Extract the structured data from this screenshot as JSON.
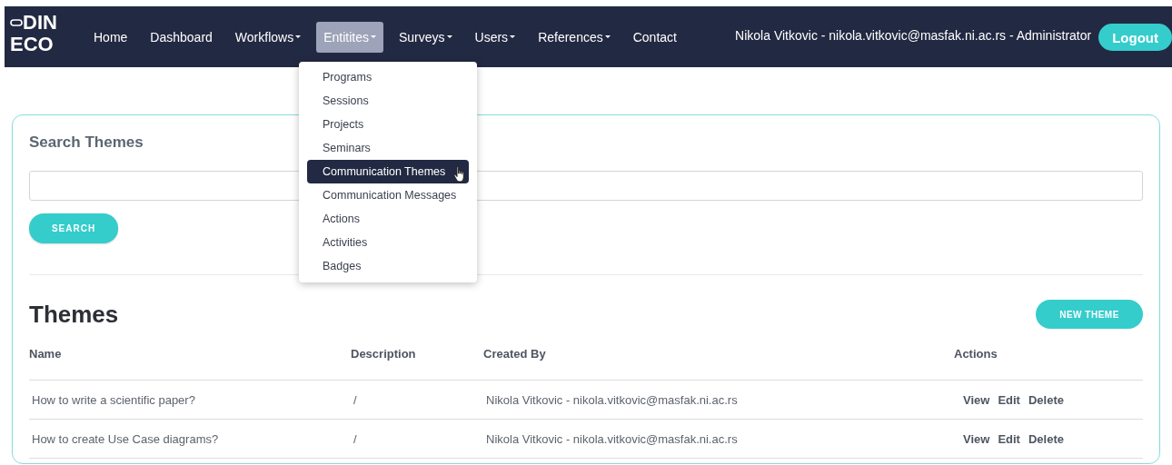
{
  "logo": {
    "line_1": "DIN",
    "line_2": "ECO"
  },
  "nav": {
    "items": [
      {
        "label": "Home",
        "has_menu": false,
        "selected": false
      },
      {
        "label": "Dashboard",
        "has_menu": false,
        "selected": false
      },
      {
        "label": "Workflows",
        "has_menu": true,
        "selected": false
      },
      {
        "label": "Entitites",
        "has_menu": true,
        "selected": true
      },
      {
        "label": "Surveys",
        "has_menu": true,
        "selected": false
      },
      {
        "label": "Users",
        "has_menu": true,
        "selected": false
      },
      {
        "label": "References",
        "has_menu": true,
        "selected": false
      },
      {
        "label": "Contact",
        "has_menu": false,
        "selected": false
      }
    ]
  },
  "user_info": "Nikola Vitkovic - nikola.vitkovic@masfak.ni.ac.rs - Administrator",
  "logout_button": "Logout",
  "dropdown": {
    "items": [
      {
        "label": "Programs",
        "selected": false
      },
      {
        "label": "Sessions",
        "selected": false
      },
      {
        "label": "Projects",
        "selected": false
      },
      {
        "label": "Seminars",
        "selected": false
      },
      {
        "label": "Communication Themes",
        "selected": true
      },
      {
        "label": "Communication Messages",
        "selected": false
      },
      {
        "label": "Actions",
        "selected": false
      },
      {
        "label": "Activities",
        "selected": false
      },
      {
        "label": "Badges",
        "selected": false
      }
    ]
  },
  "search": {
    "title": "Search Themes",
    "button": "SEARCH"
  },
  "themes": {
    "title": "Themes",
    "new_button": "NEW THEME",
    "columns": [
      "Name",
      "Description",
      "Created By",
      "Actions"
    ],
    "rows": [
      {
        "name": "How to write a scientific paper?",
        "description": "/",
        "created_by": "Nikola Vitkovic - nikola.vitkovic@masfak.ni.ac.rs",
        "actions": [
          "View",
          "Edit",
          "Delete"
        ]
      },
      {
        "name": "How to create Use Case diagrams?",
        "description": "/",
        "created_by": "Nikola Vitkovic - nikola.vitkovic@masfak.ni.ac.rs",
        "actions": [
          "View",
          "Edit",
          "Delete"
        ]
      }
    ]
  }
}
